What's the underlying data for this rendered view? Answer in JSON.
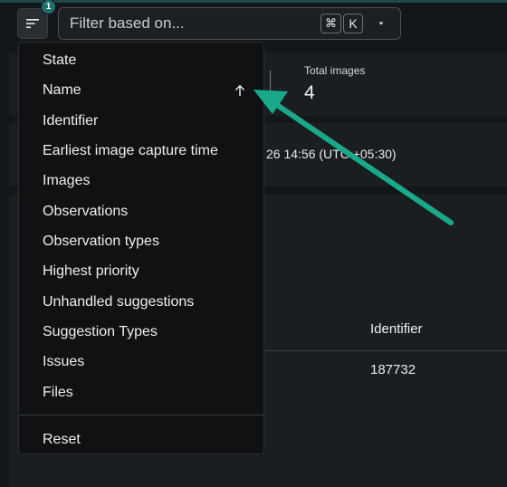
{
  "toolbar": {
    "sort_badge": "1",
    "filter_placeholder": "Filter based on...",
    "shortcut_cmd": "⌘",
    "shortcut_key": "K"
  },
  "summary": {
    "total_images_label": "Total images",
    "total_images_value": "4",
    "capture_time_fragment": "26 14:56 (UTC +05:30)"
  },
  "table": {
    "column_identifier": "Identifier",
    "row_identifier": "187732"
  },
  "sort_menu": {
    "items": [
      {
        "label": "State"
      },
      {
        "label": "Name",
        "active_sort": "ascending"
      },
      {
        "label": "Identifier"
      },
      {
        "label": "Earliest image capture time"
      },
      {
        "label": "Images"
      },
      {
        "label": "Observations"
      },
      {
        "label": "Observation types"
      },
      {
        "label": "Highest priority"
      },
      {
        "label": "Unhandled suggestions"
      },
      {
        "label": "Suggestion Types"
      },
      {
        "label": "Issues"
      },
      {
        "label": "Files"
      }
    ],
    "reset_label": "Reset"
  },
  "colors": {
    "accent": "#1f6f6b",
    "annotation_arrow": "#1aa88a"
  }
}
